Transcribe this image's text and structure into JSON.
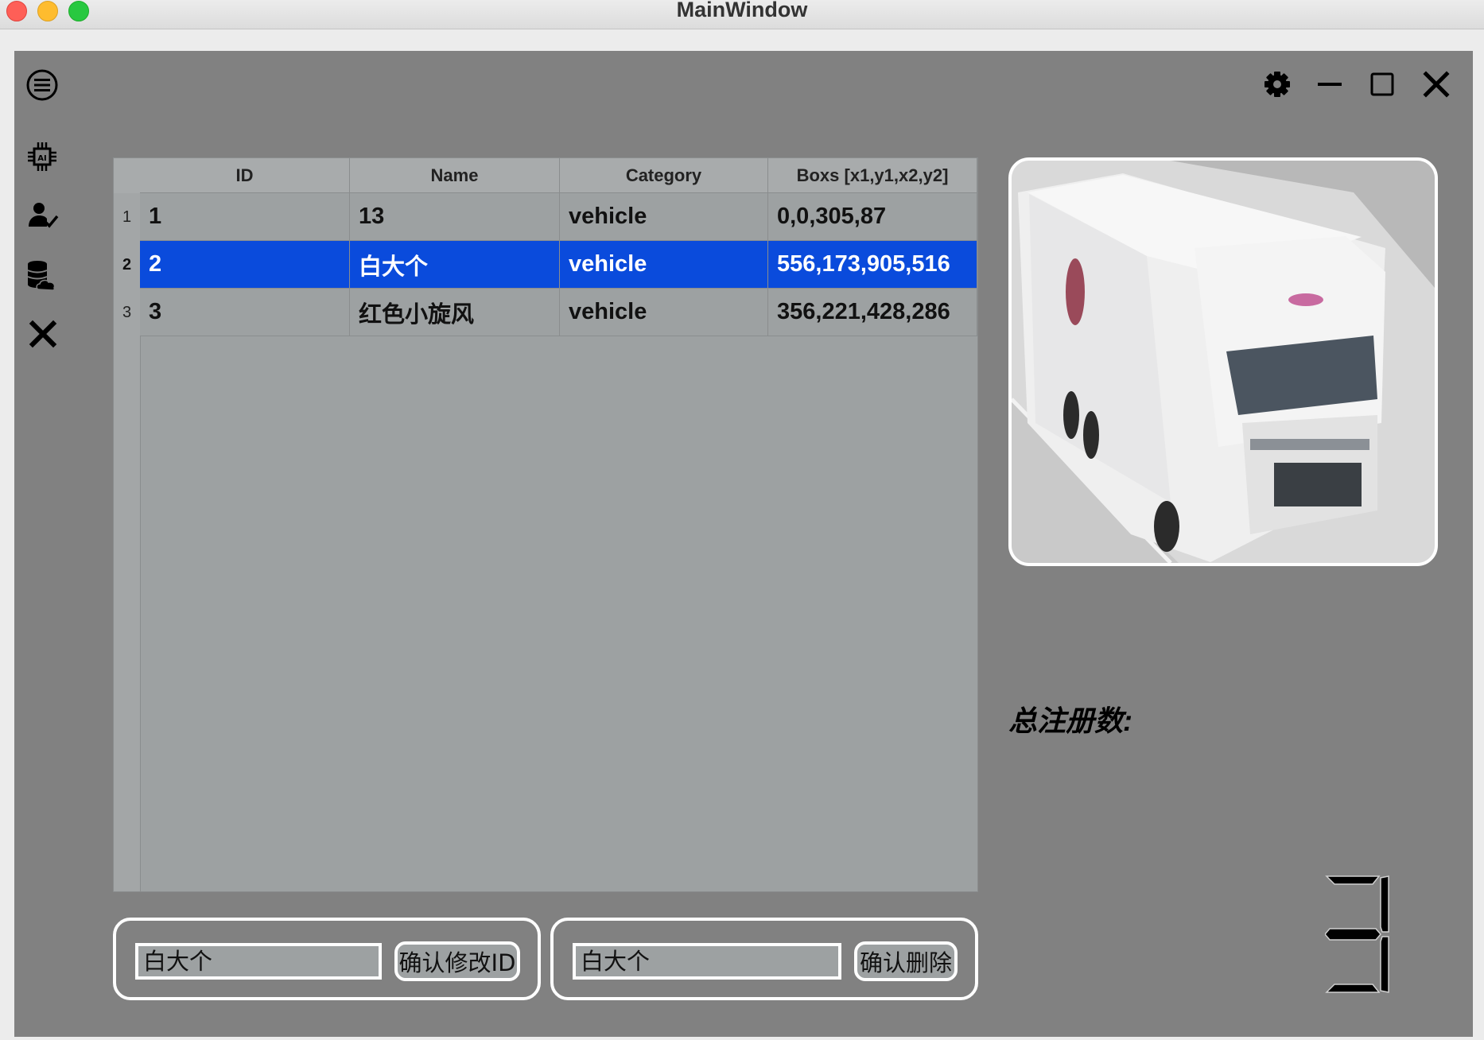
{
  "window": {
    "title": "MainWindow"
  },
  "sidebar": {
    "items": [
      {
        "icon": "menu-icon"
      },
      {
        "icon": "ai-chip-icon"
      },
      {
        "icon": "user-check-icon"
      },
      {
        "icon": "database-cloud-icon"
      },
      {
        "icon": "close-icon"
      }
    ]
  },
  "header_controls": [
    "gear-icon",
    "minimize-icon",
    "maximize-icon",
    "close-icon"
  ],
  "table": {
    "columns": [
      "ID",
      "Name",
      "Category",
      "Boxs [x1,y1,x2,y2]"
    ],
    "rows": [
      {
        "num": "1",
        "id": "1",
        "name": "13",
        "category": "vehicle",
        "boxs": "0,0,305,87",
        "selected": false
      },
      {
        "num": "2",
        "id": "2",
        "name": "白大个",
        "category": "vehicle",
        "boxs": "556,173,905,516",
        "selected": true
      },
      {
        "num": "3",
        "id": "3",
        "name": "红色小旋风",
        "category": "vehicle",
        "boxs": "356,221,428,286",
        "selected": false
      }
    ]
  },
  "stats": {
    "total_label": "总注册数:",
    "total_value": "3"
  },
  "edit": {
    "input_value": "白大个",
    "button_label": "确认修改ID"
  },
  "delete": {
    "input_value": "白大个",
    "button_label": "确认删除"
  },
  "colors": {
    "background": "#818181",
    "table_bg": "#9da1a2",
    "selection": "#0a4bdc",
    "frame": "#ffffff"
  }
}
